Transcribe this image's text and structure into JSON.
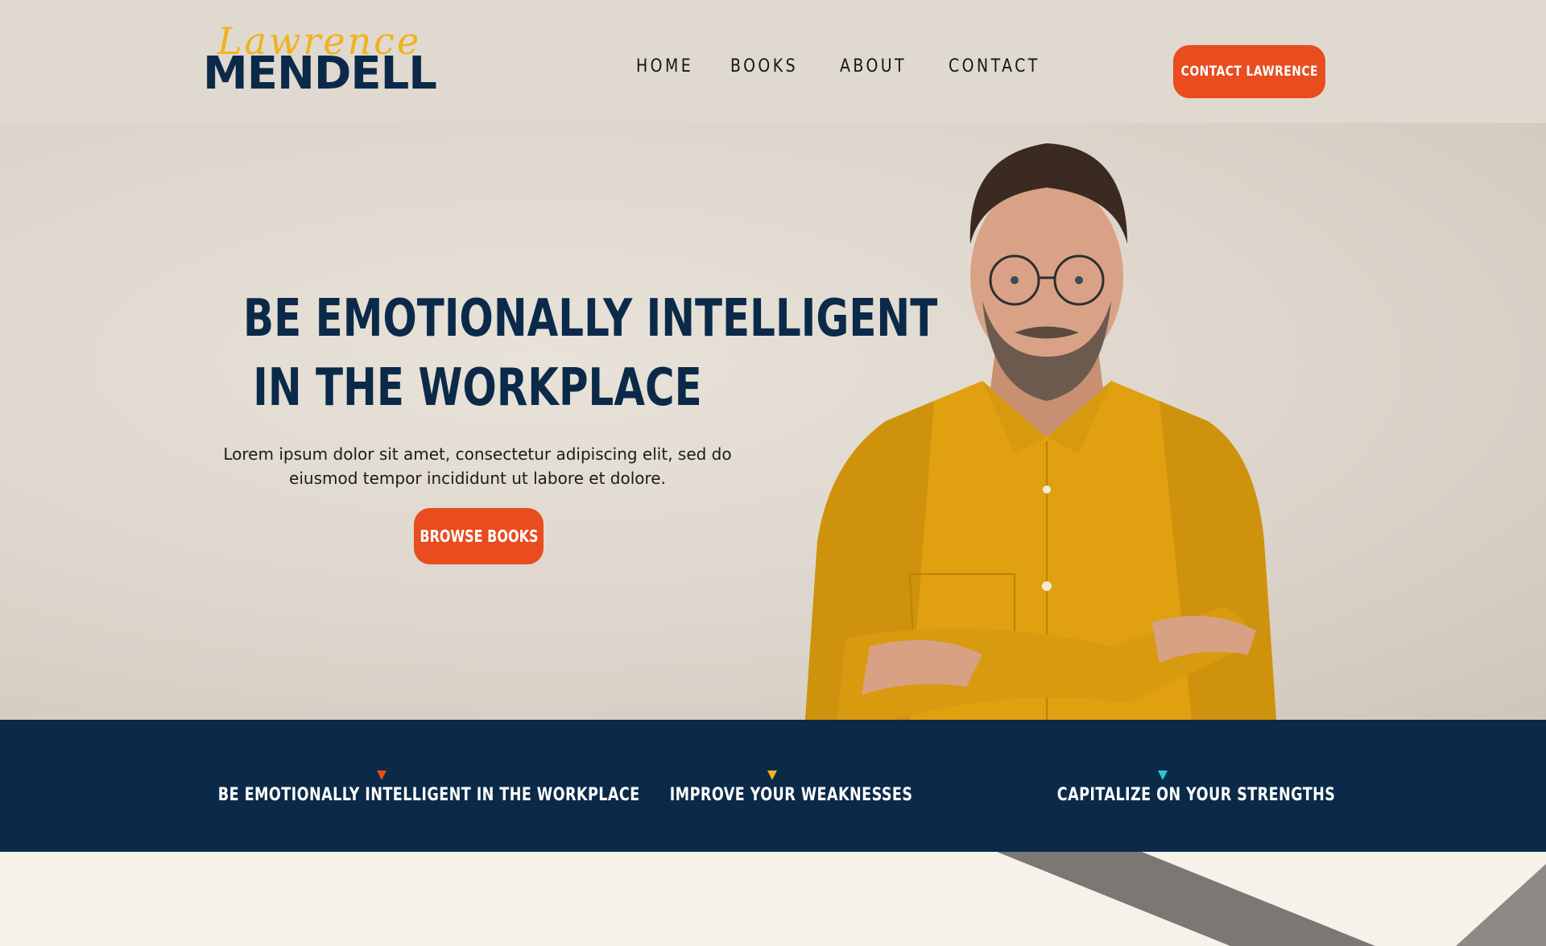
{
  "header": {
    "logo_script": "Lawrence",
    "logo_main": "MENDELL",
    "nav": [
      "HOME",
      "BOOKS",
      "ABOUT",
      "CONTACT"
    ],
    "cta": "CONTACT LAWRENCE"
  },
  "hero": {
    "title_line1": "BE EMOTIONALLY INTELLIGENT",
    "title_line2": "IN THE WORKPLACE",
    "text": "Lorem ipsum dolor sit amet, consectetur adipiscing elit, sed do eiusmod tempor incididunt ut labore et dolore.",
    "button": "BROWSE BOOKS"
  },
  "features": [
    {
      "label": "BE EMOTIONALLY INTELLIGENT IN THE WORKPLACE",
      "accent": "#e84c1f"
    },
    {
      "label": "IMPROVE YOUR WEAKNESSES",
      "accent": "#f0b21b"
    },
    {
      "label": "CAPITALIZE ON YOUR STRENGTHS",
      "accent": "#2ec4d6"
    }
  ],
  "colors": {
    "navy": "#0a2a48",
    "orange": "#e84c1f",
    "yellow": "#f0b21b",
    "cyan": "#2ec4d6",
    "header_bg": "#dfd9cf"
  }
}
